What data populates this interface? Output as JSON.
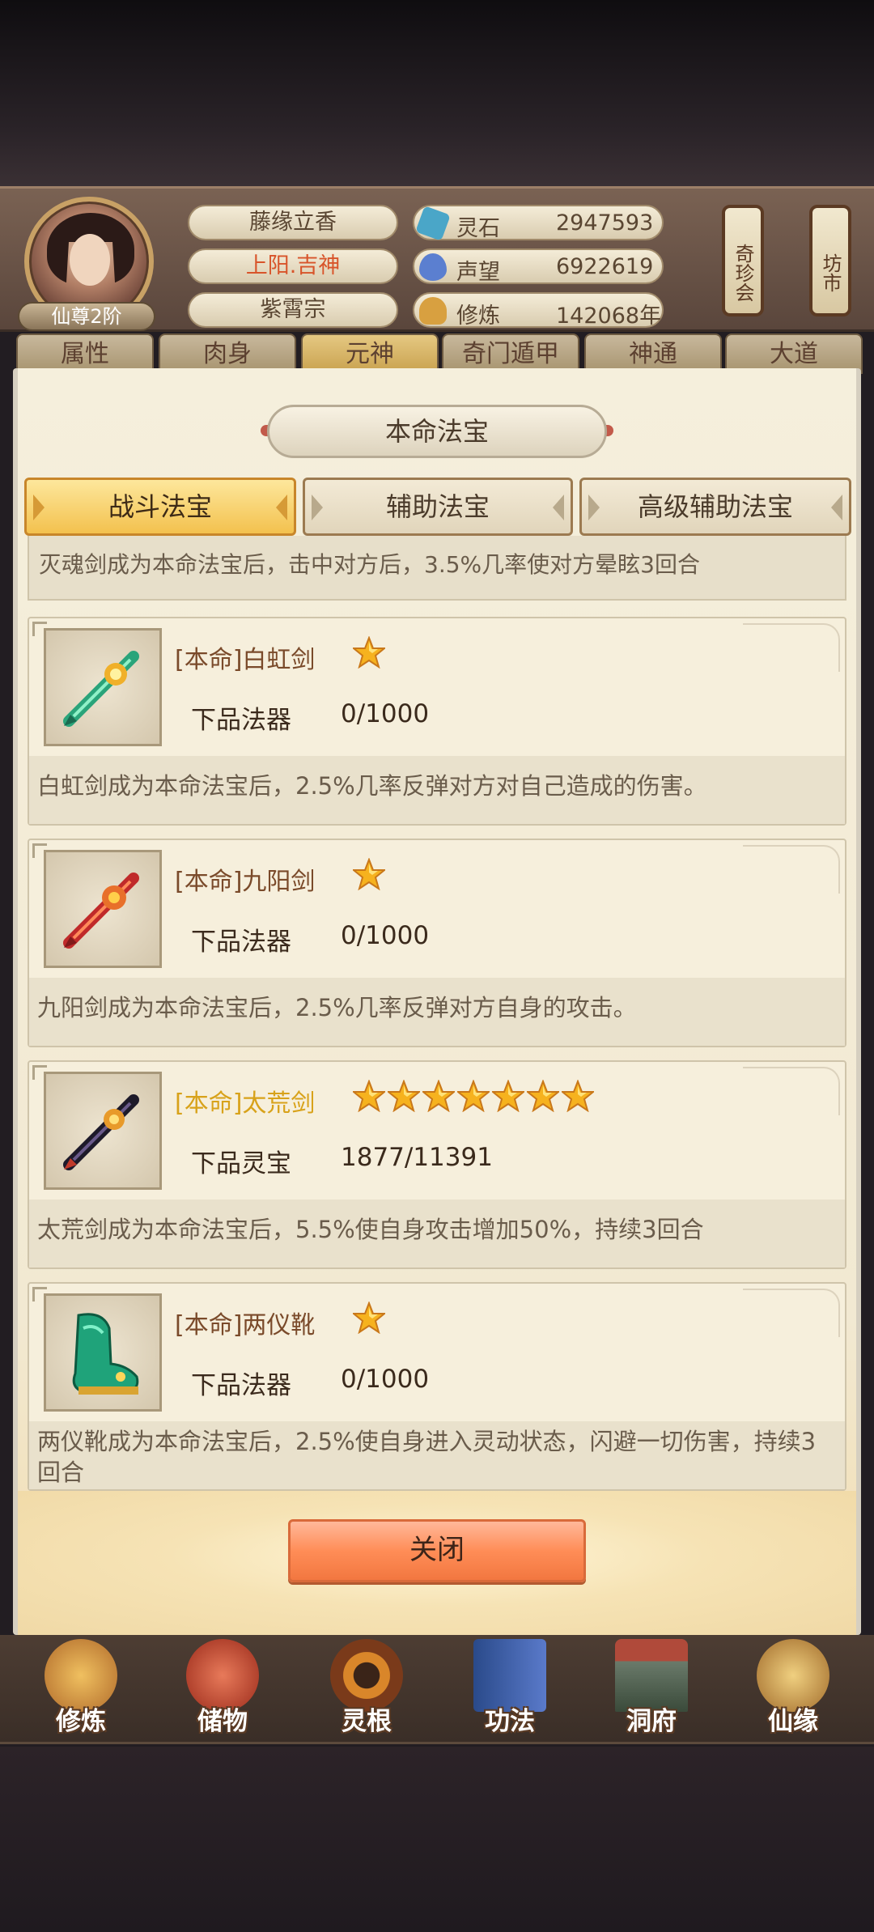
{
  "header": {
    "rank": "仙尊2阶",
    "name": "藤缘立香",
    "title": "上阳.吉神",
    "sect": "紫霄宗",
    "stats": [
      {
        "label": "灵石",
        "value": "2947593",
        "icon": "spirit-stone-icon",
        "color": "#4aa6c8"
      },
      {
        "label": "声望",
        "value": "6922619",
        "icon": "reputation-icon",
        "color": "#5b7fd0"
      },
      {
        "label": "修炼",
        "value": "142068年",
        "icon": "cultivation-icon",
        "color": "#d8a040"
      }
    ],
    "lanterns": [
      "奇珍会",
      "坊市"
    ]
  },
  "back_tabs": [
    "属性",
    "肉身",
    "元神",
    "奇门遁甲",
    "神通",
    "大道"
  ],
  "panel": {
    "title": "本命法宝",
    "tabs": [
      "战斗法宝",
      "辅助法宝",
      "高级辅助法宝"
    ],
    "top_desc": "灭魂剑成为本命法宝后，击中对方后，3.5%几率使对方晕眩3回合",
    "items": [
      {
        "name": "[本命]白虹剑",
        "stars": 1,
        "grade": "下品法器",
        "progress": "0/1000",
        "desc": "白虹剑成为本命法宝后，2.5%几率反弹对方对自己造成的伤害。",
        "icon": "white-rainbow-sword-icon"
      },
      {
        "name": "[本命]九阳剑",
        "stars": 1,
        "grade": "下品法器",
        "progress": "0/1000",
        "desc": "九阳剑成为本命法宝后，2.5%几率反弹对方自身的攻击。",
        "icon": "nine-sun-sword-icon"
      },
      {
        "name": "[本命]太荒剑",
        "stars": 7,
        "grade": "下品灵宝",
        "progress": "1877/11391",
        "desc": "太荒剑成为本命法宝后，5.5%使自身攻击增加50%，持续3回合",
        "icon": "primordial-sword-icon"
      },
      {
        "name": "[本命]两仪靴",
        "stars": 1,
        "grade": "下品法器",
        "progress": "0/1000",
        "desc": "两仪靴成为本命法宝后，2.5%使自身进入灵动状态，闪避一切伤害，持续3回合",
        "icon": "two-poles-boots-icon"
      }
    ],
    "close_label": "关闭"
  },
  "nav": [
    {
      "label": "修炼",
      "icon": "cultivate-icon",
      "color": "#d49a3a"
    },
    {
      "label": "储物",
      "icon": "storage-bag-icon",
      "color": "#c0503a"
    },
    {
      "label": "灵根",
      "icon": "spirit-root-icon",
      "color": "#9a4a2a"
    },
    {
      "label": "功法",
      "icon": "technique-book-icon",
      "color": "#3a5a9a"
    },
    {
      "label": "洞府",
      "icon": "cave-dwelling-icon",
      "color": "#6a4a3a"
    },
    {
      "label": "仙缘",
      "icon": "immortal-fate-icon",
      "color": "#c08a3a"
    }
  ]
}
